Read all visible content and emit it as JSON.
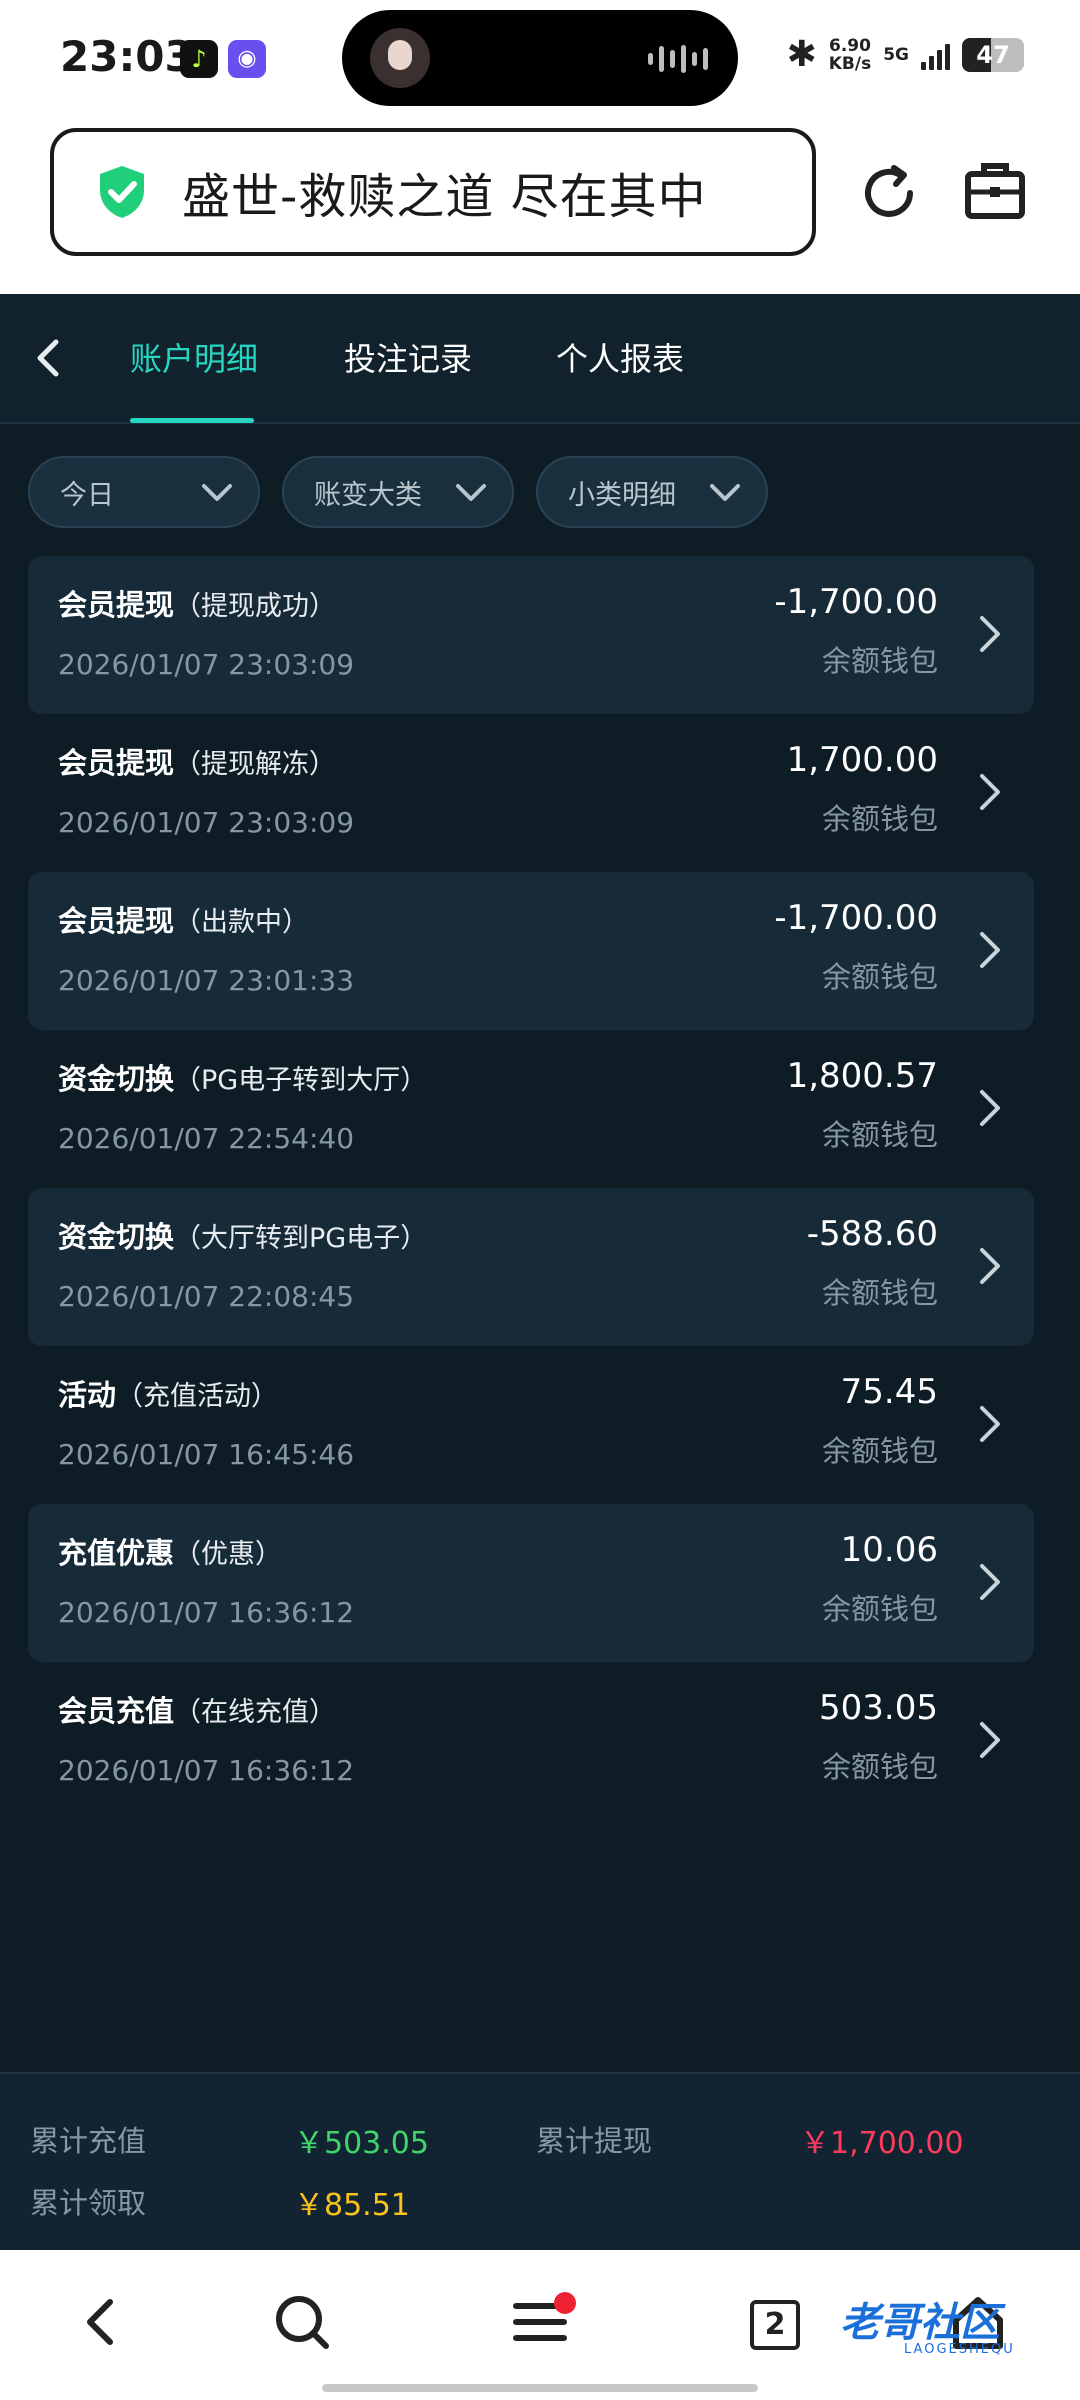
{
  "status_bar": {
    "time": "23:03",
    "speed_value": "6.90",
    "speed_unit": "KB/s",
    "network": "5G",
    "battery": "47",
    "battery_level": 0.47
  },
  "browser": {
    "url_title": "盛世-救赎之道 尽在其中",
    "icons": [
      "shield-check-icon",
      "refresh-icon",
      "toolbox-icon"
    ]
  },
  "tabs": [
    {
      "label": "账户明细",
      "active": true
    },
    {
      "label": "投注记录",
      "active": false
    },
    {
      "label": "个人报表",
      "active": false
    }
  ],
  "filters": [
    {
      "label": "今日"
    },
    {
      "label": "账变大类"
    },
    {
      "label": "小类明细"
    }
  ],
  "transactions": [
    {
      "type": "会员提现",
      "detail": "（提现成功）",
      "datetime": "2026/01/07 23:03:09",
      "amount": "-1,700.00",
      "wallet": "余额钱包"
    },
    {
      "type": "会员提现",
      "detail": "（提现解冻）",
      "datetime": "2026/01/07 23:03:09",
      "amount": "1,700.00",
      "wallet": "余额钱包"
    },
    {
      "type": "会员提现",
      "detail": "（出款中）",
      "datetime": "2026/01/07 23:01:33",
      "amount": "-1,700.00",
      "wallet": "余额钱包"
    },
    {
      "type": "资金切换",
      "detail": "（PG电子转到大厅）",
      "datetime": "2026/01/07 22:54:40",
      "amount": "1,800.57",
      "wallet": "余额钱包"
    },
    {
      "type": "资金切换",
      "detail": "（大厅转到PG电子）",
      "datetime": "2026/01/07 22:08:45",
      "amount": "-588.60",
      "wallet": "余额钱包"
    },
    {
      "type": "活动",
      "detail": "（充值活动）",
      "datetime": "2026/01/07 16:45:46",
      "amount": "75.45",
      "wallet": "余额钱包"
    },
    {
      "type": "充值优惠",
      "detail": "（优惠）",
      "datetime": "2026/01/07 16:36:12",
      "amount": "10.06",
      "wallet": "余额钱包"
    },
    {
      "type": "会员充值",
      "detail": "（在线充值）",
      "datetime": "2026/01/07 16:36:12",
      "amount": "503.05",
      "wallet": "余额钱包"
    }
  ],
  "summary": {
    "total_deposit_label": "累计充值",
    "total_deposit_value": "￥503.05",
    "total_withdraw_label": "累计提现",
    "total_withdraw_value": "￥1,700.00",
    "total_claim_label": "累计领取",
    "total_claim_value": "￥85.51"
  },
  "bottom_nav": {
    "tab_count": "2",
    "watermark": "老哥社区",
    "watermark_sub": "LAOGESHEQU"
  },
  "colors": {
    "accent": "#27d6c0",
    "background": "#0e1c26",
    "deposit": "#3fd56b",
    "withdraw": "#ff3b5c",
    "claim": "#f7c21c"
  }
}
